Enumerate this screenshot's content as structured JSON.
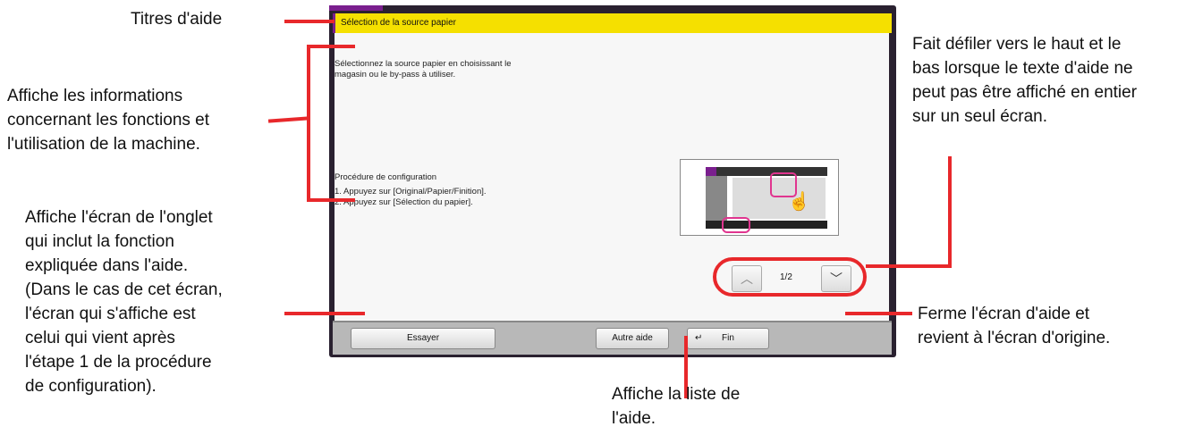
{
  "screen": {
    "title": "Sélection de la source papier",
    "description_line1": "Sélectionnez la source papier en choisissant le",
    "description_line2": "magasin ou le by-pass à utiliser.",
    "procedure_heading": "Procédure de configuration",
    "steps": [
      "1. Appuyez sur [Original/Papier/Finition].",
      "2. Appuyez sur [Sélection du papier]."
    ],
    "page_indicator": "1/2",
    "buttons": {
      "try": "Essayer",
      "other_help": "Autre aide",
      "end": "Fin"
    }
  },
  "callouts": {
    "help_title": "Titres d'aide",
    "info": [
      "Affiche les informations",
      "concernant les fonctions et",
      "l'utilisation de la machine."
    ],
    "try": [
      "Affiche l'écran de l'onglet",
      "qui inclut la fonction",
      "expliquée dans l'aide.",
      "(Dans le cas de cet écran,",
      "l'écran qui s'affiche est",
      "celui qui vient après",
      "l'étape 1 de la procédure",
      "de configuration)."
    ],
    "scroll": [
      "Fait défiler vers le haut et le",
      "bas lorsque le texte d'aide ne",
      "peut pas être affiché en entier",
      "sur un seul écran."
    ],
    "end": [
      "Ferme l'écran d'aide et",
      "revient à l'écran d'origine."
    ],
    "other_help": [
      "Affiche la liste de",
      "l'aide."
    ]
  },
  "colors": {
    "callout": "#e8282b",
    "title_bar": "#f5e000",
    "accent": "#7a1f8e",
    "highlight": "#e0358f"
  }
}
